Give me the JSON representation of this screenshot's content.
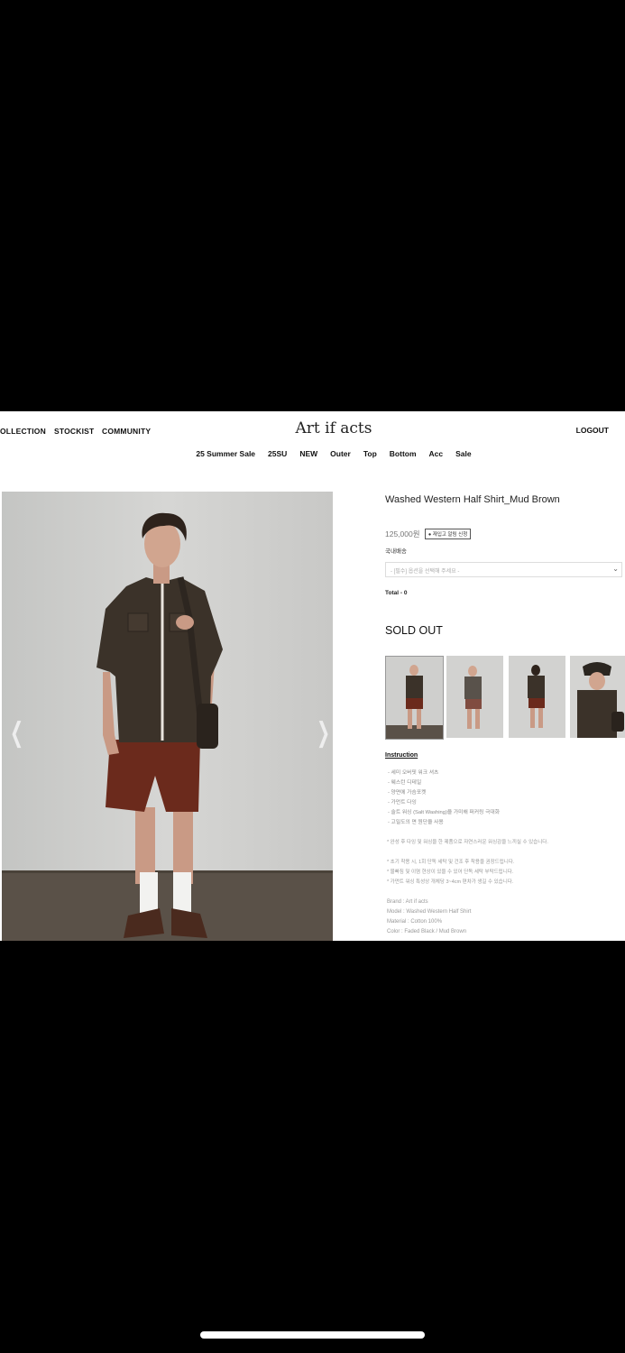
{
  "header": {
    "nav_left": [
      "OLLECTION",
      "STOCKIST",
      "COMMUNITY"
    ],
    "logo": "Art if acts",
    "logout_label": "LOGOUT"
  },
  "categories": [
    "25 Summer Sale",
    "25SU",
    "NEW",
    "Outer",
    "Top",
    "Bottom",
    "Acc",
    "Sale"
  ],
  "product": {
    "title": "Washed Western Half Shirt_Mud Brown",
    "price": "125,000원",
    "restock_label": "재입고 알림 신청",
    "shipping": "국내배송",
    "option_placeholder": "- [필수] 옵션을 선택해 주세요 -",
    "total": "Total - 0",
    "status": "SOLD OUT"
  },
  "description": {
    "heading": "Instruction",
    "features": [
      "- 세미 오버핏 워크 셔츠",
      "- 웨스턴 디테일",
      "- 양면에 가슴포켓",
      "- 가먼트 다잉",
      "- 솔트 워싱 (Salt Washing)을 가미해 퍼커링 극대화",
      "- 고밀도의 면 원단을 사용"
    ],
    "note1": "* 완성 후 다잉 및 워싱을 한 제품으로 자연스러운 워싱감을 느끼실 수 있습니다.",
    "care": [
      "* 초기 착용 시, 1회 단독 세탁 및 건조 후 착용을 권장드립니다.",
      "* 물빠짐 및 이염 현상이 있을 수 있어 단독 세탁 부탁드립니다.",
      "* 가먼트 워싱 특성상 개체당 3~4cm 편차가 생길 수 있습니다."
    ],
    "specs": [
      "Brand : Art if acts",
      "Model : Washed Western Half Shirt",
      "Material : Cotton 100%",
      "Color : Faded Black / Mud Brown"
    ]
  },
  "icons": {
    "prev": "chevron-left-icon",
    "next": "chevron-right-icon",
    "bell": "bell-icon",
    "select_arrow": "chevron-down-icon"
  },
  "colors": {
    "background": "#000000",
    "page": "#ffffff",
    "shirt": "#3b3229",
    "shorts": "#6b2a1c",
    "wall": "#cfcfcd",
    "floor": "#5a5148"
  }
}
